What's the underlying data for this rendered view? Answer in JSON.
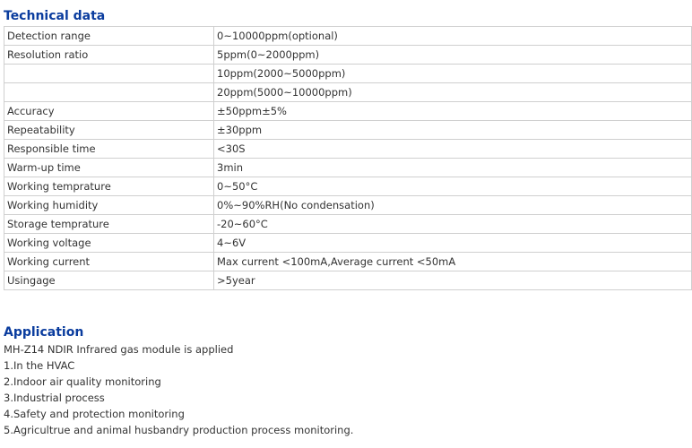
{
  "technical": {
    "heading": "Technical data",
    "rows": [
      {
        "label": "Detection range",
        "value": "0~10000ppm(optional)"
      },
      {
        "label": "Resolution ratio",
        "value": "5ppm(0~2000ppm)"
      },
      {
        "label": "",
        "value": "10ppm(2000~5000ppm)"
      },
      {
        "label": "",
        "value": "20ppm(5000~10000ppm)"
      },
      {
        "label": "Accuracy",
        "value": "±50ppm±5%"
      },
      {
        "label": "Repeatability",
        "value": "±30ppm"
      },
      {
        "label": "Responsible time",
        "value": "<30S"
      },
      {
        "label": "Warm-up time",
        "value": "3min"
      },
      {
        "label": "Working temprature",
        "value": "0~50°C"
      },
      {
        "label": "Working humidity",
        "value": "0%~90%RH(No condensation)"
      },
      {
        "label": "Storage temprature",
        "value": "-20~60°C"
      },
      {
        "label": "Working voltage",
        "value": "4~6V"
      },
      {
        "label": "Working current",
        "value": "Max current <100mA,Average current <50mA"
      },
      {
        "label": "Usingage",
        "value": ">5year"
      }
    ]
  },
  "application": {
    "heading": "Application",
    "intro": "MH-Z14 NDIR Infrared gas module is applied",
    "items": [
      "1.In the HVAC",
      "2.Indoor air quality monitoring",
      "3.Industrial process",
      "4.Safety and protection monitoring",
      "5.Agricultrue and animal husbandry production process monitoring."
    ]
  }
}
